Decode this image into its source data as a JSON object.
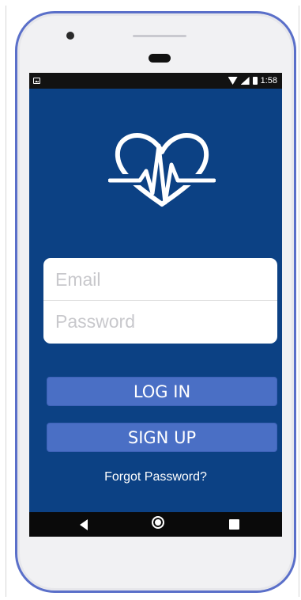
{
  "status_bar": {
    "time": "1:58",
    "icons": [
      "image-icon",
      "wifi-icon",
      "signal-icon",
      "battery-icon"
    ]
  },
  "logo": {
    "icon": "heart-pulse-icon"
  },
  "login_form": {
    "email_placeholder": "Email",
    "password_placeholder": "Password",
    "email_value": "",
    "password_value": ""
  },
  "actions": {
    "login_label": "LOG IN",
    "signup_label": "SIGN UP",
    "forgot_label": "Forgot Password?"
  },
  "nav_bar": {
    "icons": [
      "back-icon",
      "home-icon",
      "recents-icon"
    ]
  },
  "colors": {
    "screen_background": "#0c4184",
    "button": "#4a6fc5",
    "phone_outline": "#5a6fc9"
  }
}
